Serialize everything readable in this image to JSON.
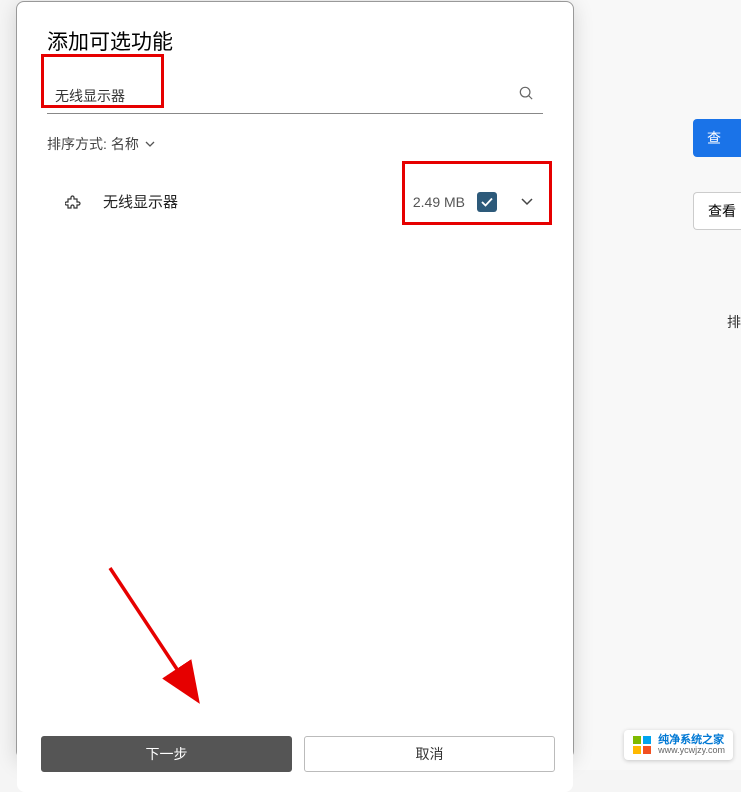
{
  "dialog": {
    "title": "添加可选功能",
    "search_value": "无线显示器",
    "sort_label": "排序方式:",
    "sort_value": "名称",
    "feature": {
      "name": "无线显示器",
      "size": "2.49 MB",
      "checked": true
    },
    "next_button": "下一步",
    "cancel_button": "取消"
  },
  "background": {
    "btn1": "查",
    "btn2": "查看",
    "text1": "排"
  },
  "watermark": {
    "title": "纯净系统之家",
    "url": "www.ycwjzy.com"
  }
}
